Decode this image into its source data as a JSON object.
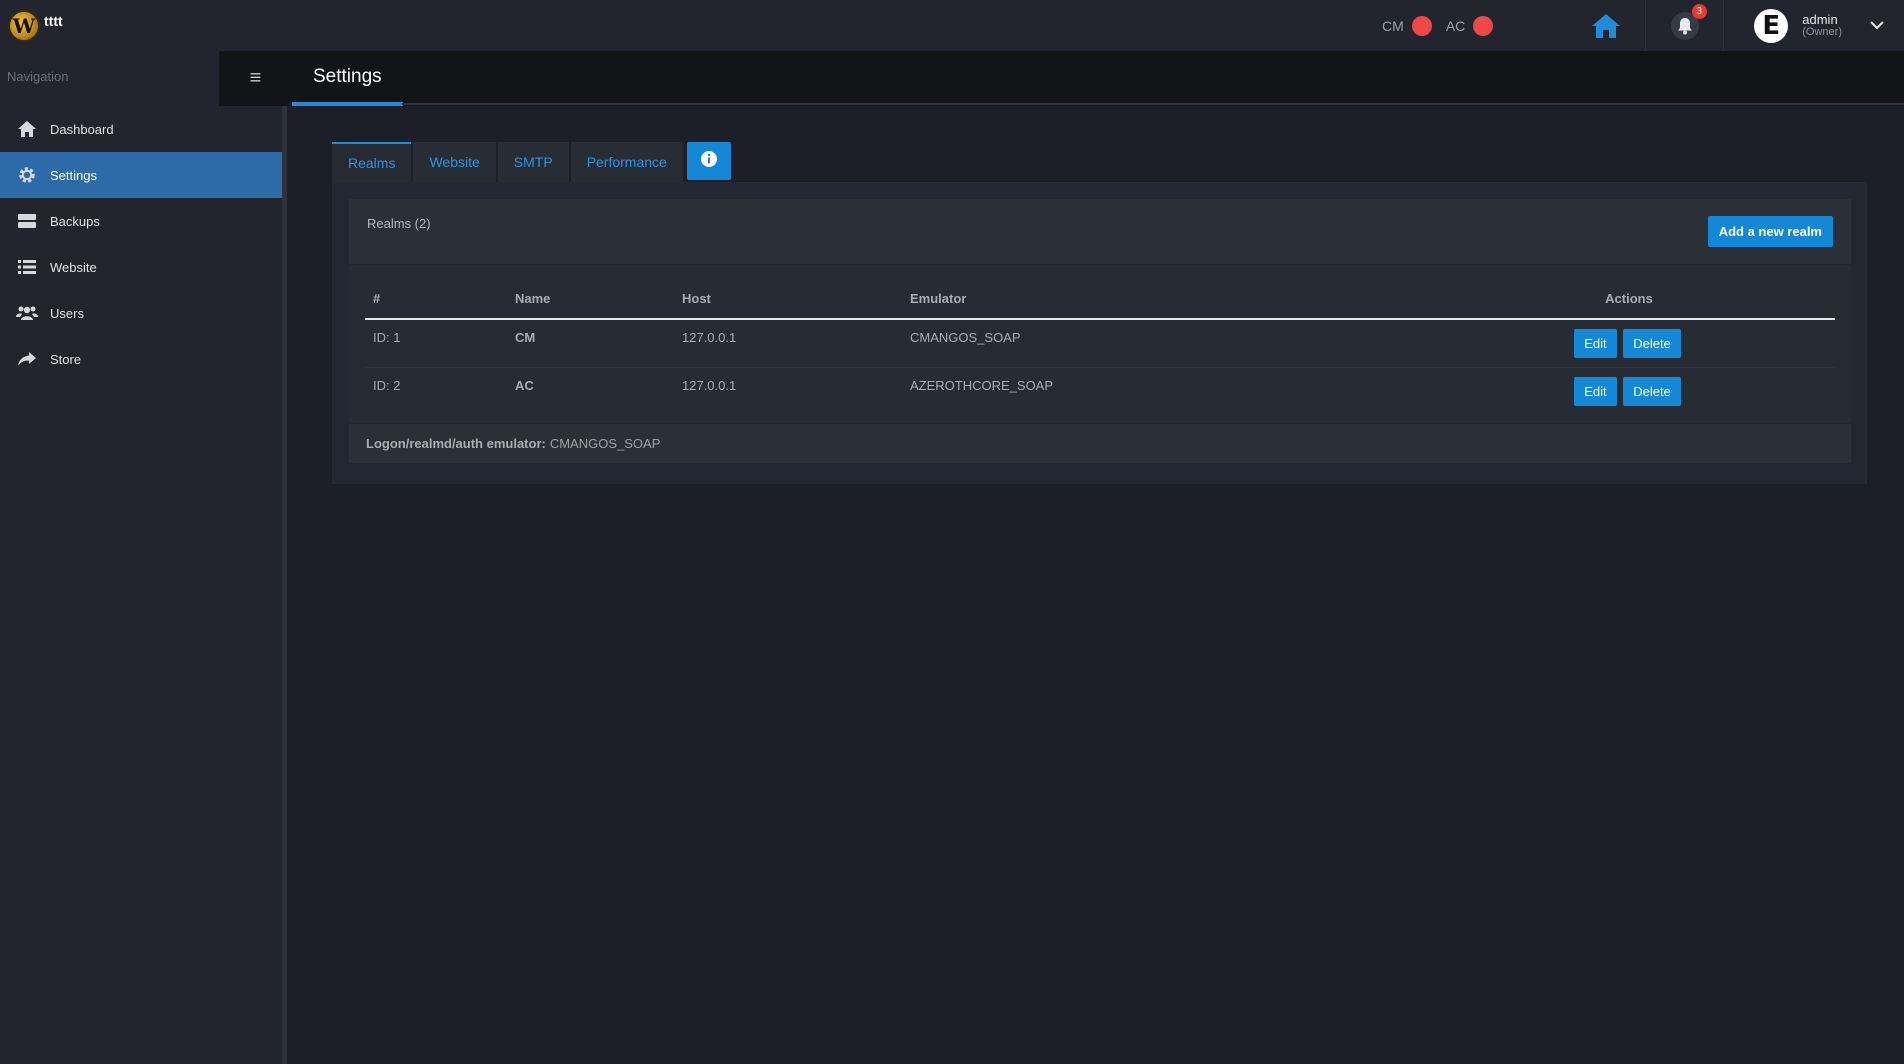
{
  "brand": {
    "name": "tttt",
    "logo_letter": "W"
  },
  "status": [
    {
      "label": "CM",
      "color": "#ef4848"
    },
    {
      "label": "AC",
      "color": "#ef4848"
    }
  ],
  "notifications": {
    "count": "3"
  },
  "user": {
    "avatar_letter": "E",
    "name": "admin",
    "role": "(Owner)"
  },
  "sidebar": {
    "title": "Navigation",
    "items": [
      {
        "label": "Dashboard",
        "icon": "home-icon"
      },
      {
        "label": "Settings",
        "icon": "gear-icon",
        "active": true
      },
      {
        "label": "Backups",
        "icon": "server-icon"
      },
      {
        "label": "Website",
        "icon": "list-icon"
      },
      {
        "label": "Users",
        "icon": "users-icon"
      },
      {
        "label": "Store",
        "icon": "share-icon"
      }
    ]
  },
  "header": {
    "menu_glyph": "≡",
    "title": "Settings"
  },
  "tabs": [
    {
      "label": "Realms",
      "active": true
    },
    {
      "label": "Website"
    },
    {
      "label": "SMTP"
    },
    {
      "label": "Performance"
    }
  ],
  "realms": {
    "title": "Realms (2)",
    "add_label": "Add a new realm",
    "columns": {
      "id": "#",
      "name": "Name",
      "host": "Host",
      "emulator": "Emulator",
      "actions": "Actions"
    },
    "rows": [
      {
        "id": "ID: 1",
        "name": "CM",
        "host": "127.0.0.1",
        "emulator": "CMANGOS_SOAP",
        "edit": "Edit",
        "delete": "Delete"
      },
      {
        "id": "ID: 2",
        "name": "AC",
        "host": "127.0.0.1",
        "emulator": "AZEROTHCORE_SOAP",
        "edit": "Edit",
        "delete": "Delete"
      }
    ],
    "footer_label": "Logon/realmd/auth emulator:",
    "footer_value": "CMANGOS_SOAP"
  }
}
